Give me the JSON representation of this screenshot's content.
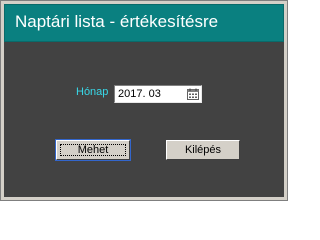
{
  "window": {
    "title": "Naptári lista - értékesítésre"
  },
  "form": {
    "month_label": "Hónap",
    "month_value": "2017. 03"
  },
  "buttons": {
    "go_label": "Mehet",
    "exit_label": "Kilépés"
  },
  "icons": {
    "date_picker": "calendar-icon"
  },
  "colors": {
    "title_bar": "#0a8080",
    "panel": "#424242",
    "label": "#38d8e8"
  }
}
